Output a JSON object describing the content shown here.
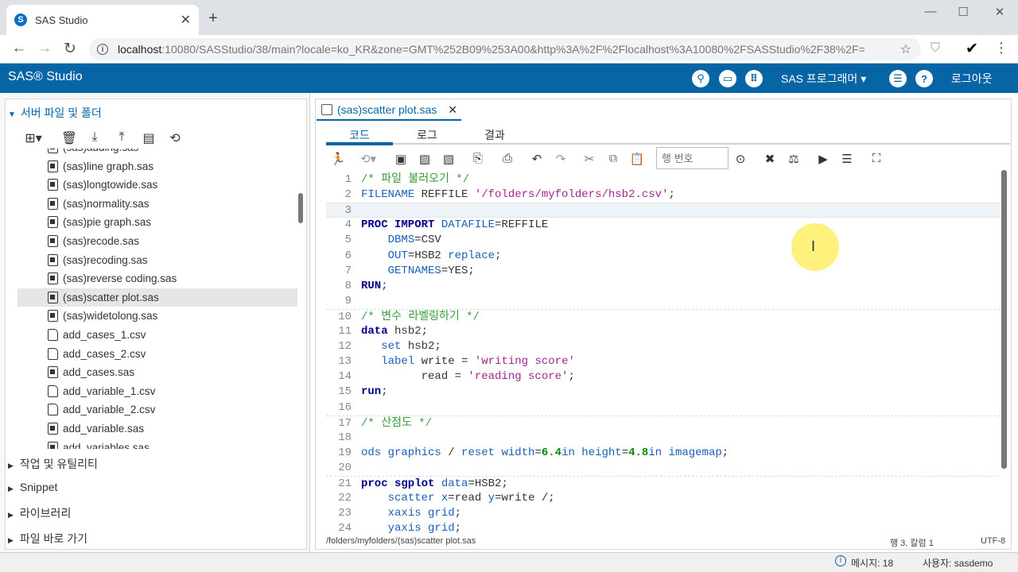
{
  "browser": {
    "tab_title": "SAS Studio",
    "tab_favicon": "S",
    "new_tab": "+",
    "url_host": "localhost",
    "url_rest": ":10080/SASStudio/38/main?locale=ko_KR&zone=GMT%252B09%253A00&http%3A%2F%2Flocalhost%3A10080%2FSASStudio%2F38%2F="
  },
  "header": {
    "logo": "SAS® Studio",
    "program_menu": "SAS 프로그래머 ▾",
    "logout": "로그아웃"
  },
  "left": {
    "section_title": "서버 파일 및 폴더",
    "files": [
      {
        "name": "(sas)adding.sas",
        "type": "sas"
      },
      {
        "name": "(sas)line graph.sas",
        "type": "sas"
      },
      {
        "name": "(sas)longtowide.sas",
        "type": "sas"
      },
      {
        "name": "(sas)normality.sas",
        "type": "sas"
      },
      {
        "name": "(sas)pie graph.sas",
        "type": "sas"
      },
      {
        "name": "(sas)recode.sas",
        "type": "sas"
      },
      {
        "name": "(sas)recoding.sas",
        "type": "sas"
      },
      {
        "name": "(sas)reverse coding.sas",
        "type": "sas"
      },
      {
        "name": "(sas)scatter plot.sas",
        "type": "sas",
        "selected": true
      },
      {
        "name": "(sas)widetolong.sas",
        "type": "sas"
      },
      {
        "name": "add_cases_1.csv",
        "type": "csv"
      },
      {
        "name": "add_cases_2.csv",
        "type": "csv"
      },
      {
        "name": "add_cases.sas",
        "type": "sas"
      },
      {
        "name": "add_variable_1.csv",
        "type": "csv"
      },
      {
        "name": "add_variable_2.csv",
        "type": "csv"
      },
      {
        "name": "add_variable.sas",
        "type": "sas"
      },
      {
        "name": "add_variables.sas",
        "type": "sas"
      }
    ],
    "sections": [
      "작업 및 유틸리티",
      "Snippet",
      "라이브러리",
      "파일 바로 가기"
    ]
  },
  "editor": {
    "doc_tab": "(sas)scatter plot.sas",
    "subtabs": [
      "코드",
      "로그",
      "결과"
    ],
    "line_input_placeholder": "행 번호",
    "code_lines": [
      {
        "n": "1",
        "parts": [
          [
            "c",
            "/* 파일 불러오기 */"
          ]
        ]
      },
      {
        "n": "2",
        "parts": [
          [
            "kw",
            "FILENAME"
          ],
          [
            "tx",
            " REFFILE "
          ],
          [
            "s",
            "'/folders/myfolders/hsb2.csv'"
          ],
          [
            "tx",
            ";"
          ]
        ]
      },
      {
        "n": "3",
        "parts": [],
        "current": true
      },
      {
        "n": "4",
        "parts": [
          [
            "k",
            "PROC IMPORT"
          ],
          [
            "tx",
            " "
          ],
          [
            "kw",
            "DATAFILE"
          ],
          [
            "tx",
            "=REFFILE"
          ]
        ]
      },
      {
        "n": "5",
        "parts": [
          [
            "tx",
            "    "
          ],
          [
            "kw",
            "DBMS"
          ],
          [
            "tx",
            "=CSV"
          ]
        ]
      },
      {
        "n": "6",
        "parts": [
          [
            "tx",
            "    "
          ],
          [
            "kw",
            "OUT"
          ],
          [
            "tx",
            "=HSB2 "
          ],
          [
            "kw",
            "replace"
          ],
          [
            "tx",
            ";"
          ]
        ]
      },
      {
        "n": "7",
        "parts": [
          [
            "tx",
            "    "
          ],
          [
            "kw",
            "GETNAMES"
          ],
          [
            "tx",
            "=YES;"
          ]
        ]
      },
      {
        "n": "8",
        "parts": [
          [
            "k",
            "RUN"
          ],
          [
            "tx",
            ";"
          ]
        ]
      },
      {
        "n": "9",
        "parts": []
      },
      {
        "n": "10",
        "parts": [
          [
            "c",
            "/* 변수 라벨링하기 */"
          ]
        ],
        "sep": true
      },
      {
        "n": "11",
        "parts": [
          [
            "k",
            "data"
          ],
          [
            "tx",
            " hsb2;"
          ]
        ]
      },
      {
        "n": "12",
        "parts": [
          [
            "tx",
            "   "
          ],
          [
            "kw",
            "set"
          ],
          [
            "tx",
            " hsb2;"
          ]
        ]
      },
      {
        "n": "13",
        "parts": [
          [
            "tx",
            "   "
          ],
          [
            "kw",
            "label"
          ],
          [
            "tx",
            " write = "
          ],
          [
            "s",
            "'writing score'"
          ]
        ]
      },
      {
        "n": "14",
        "parts": [
          [
            "tx",
            "         read = "
          ],
          [
            "s",
            "'reading score'"
          ],
          [
            "tx",
            ";"
          ]
        ]
      },
      {
        "n": "15",
        "parts": [
          [
            "k",
            "run"
          ],
          [
            "tx",
            ";"
          ]
        ]
      },
      {
        "n": "16",
        "parts": []
      },
      {
        "n": "17",
        "parts": [
          [
            "c",
            "/* 산점도 */"
          ]
        ],
        "sep": true
      },
      {
        "n": "18",
        "parts": []
      },
      {
        "n": "19",
        "parts": [
          [
            "kw",
            "ods graphics"
          ],
          [
            "tx",
            " / "
          ],
          [
            "kw",
            "reset width"
          ],
          [
            "tx",
            "="
          ],
          [
            "n",
            "6.4"
          ],
          [
            "kw",
            "in height"
          ],
          [
            "tx",
            "="
          ],
          [
            "n",
            "4.8"
          ],
          [
            "kw",
            "in imagemap"
          ],
          [
            "tx",
            ";"
          ]
        ]
      },
      {
        "n": "20",
        "parts": []
      },
      {
        "n": "21",
        "parts": [
          [
            "k",
            "proc sgplot"
          ],
          [
            "tx",
            " "
          ],
          [
            "kw",
            "data"
          ],
          [
            "tx",
            "=HSB2;"
          ]
        ],
        "sep": true
      },
      {
        "n": "22",
        "parts": [
          [
            "tx",
            "    "
          ],
          [
            "kw",
            "scatter x"
          ],
          [
            "tx",
            "=read "
          ],
          [
            "kw",
            "y"
          ],
          [
            "tx",
            "=write /;"
          ]
        ]
      },
      {
        "n": "23",
        "parts": [
          [
            "tx",
            "    "
          ],
          [
            "kw",
            "xaxis grid"
          ],
          [
            "tx",
            ";"
          ]
        ]
      },
      {
        "n": "24",
        "parts": [
          [
            "tx",
            "    "
          ],
          [
            "kw",
            "yaxis grid"
          ],
          [
            "tx",
            ";"
          ]
        ]
      }
    ],
    "status_path": "/folders/myfolders/(sas)scatter plot.sas",
    "status_pos": "행 3, 칼럼 1",
    "status_enc": "UTF-8"
  },
  "footer": {
    "messages": "메시지: 18",
    "user": "사용자: sasdemo"
  }
}
